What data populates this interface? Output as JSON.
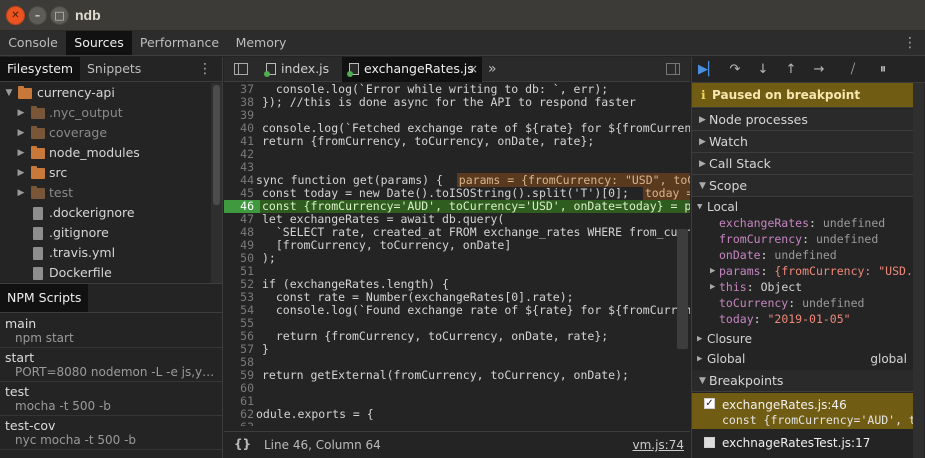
{
  "window": {
    "title": "ndb"
  },
  "main_tabs": [
    "Console",
    "Sources",
    "Performance",
    "Memory"
  ],
  "left": {
    "tabs": [
      "Filesystem",
      "Snippets"
    ],
    "tree": [
      {
        "label": "currency-api"
      },
      {
        "label": ".nyc_output"
      },
      {
        "label": "coverage"
      },
      {
        "label": "node_modules"
      },
      {
        "label": "src"
      },
      {
        "label": "test"
      },
      {
        "label": ".dockerignore"
      },
      {
        "label": ".gitignore"
      },
      {
        "label": ".travis.yml"
      },
      {
        "label": "Dockerfile"
      }
    ],
    "npm_header": "NPM Scripts",
    "npm_scripts": [
      {
        "name": "main",
        "cmd": "npm start"
      },
      {
        "name": "start",
        "cmd": "PORT=8080 nodemon -L -e js,yml,..."
      },
      {
        "name": "test",
        "cmd": "mocha -t 500 -b"
      },
      {
        "name": "test-cov",
        "cmd": "nyc mocha -t 500 -b"
      }
    ]
  },
  "editor": {
    "tabs": [
      "index.js",
      "exchangeRates.js"
    ],
    "more": "»",
    "close": "×",
    "lines": [
      {
        "n": "37",
        "t": "  console.log(`Error while writing to db: `, err);"
      },
      {
        "n": "38",
        "t": "}); //this is done async for the API to respond faster"
      },
      {
        "n": "39",
        "t": ""
      },
      {
        "n": "40",
        "t": "console.log(`Fetched exchange rate of ${rate} for ${fromCurrency}"
      },
      {
        "n": "41",
        "t": "return {fromCurrency, toCurrency, onDate, rate};"
      },
      {
        "n": "42",
        "t": ""
      },
      {
        "n": "43",
        "t": ""
      },
      {
        "n": "44",
        "t": "sync function get(params) {",
        "inline": "params = {fromCurrency: \"USD\", toCur"
      },
      {
        "n": "45",
        "t": "const today = new Date().toISOString().split('T')[0];",
        "inline": "today = \""
      },
      {
        "n": "46",
        "t": "const {fromCurrency='AUD', toCurrency='USD', onDate=today} = para"
      },
      {
        "n": "47",
        "t": "let exchangeRates = await db.query("
      },
      {
        "n": "48",
        "t": "  `SELECT rate, created_at FROM exchange_rates WHERE from_curre"
      },
      {
        "n": "49",
        "t": "  [fromCurrency, toCurrency, onDate]"
      },
      {
        "n": "50",
        "t": ");"
      },
      {
        "n": "51",
        "t": ""
      },
      {
        "n": "52",
        "t": "if (exchangeRates.length) {"
      },
      {
        "n": "53",
        "t": "  const rate = Number(exchangeRates[0].rate);"
      },
      {
        "n": "54",
        "t": "  console.log(`Found exchange rate of ${rate} for ${fromCurrency},"
      },
      {
        "n": "55",
        "t": ""
      },
      {
        "n": "56",
        "t": "  return {fromCurrency, toCurrency, onDate, rate};"
      },
      {
        "n": "57",
        "t": "}"
      },
      {
        "n": "58",
        "t": ""
      },
      {
        "n": "59",
        "t": "return getExternal(fromCurrency, toCurrency, onDate);"
      },
      {
        "n": "60",
        "t": ""
      },
      {
        "n": "61",
        "t": ""
      },
      {
        "n": "62",
        "t": "odule.exports = {"
      },
      {
        "n": "63",
        "t": ""
      }
    ],
    "status": {
      "pretty_print": "{}",
      "cursor": "Line 46, Column 64",
      "source_link": "vm.js:74"
    }
  },
  "debugger": {
    "paused_icon": "ℹ",
    "paused": "Paused on breakpoint",
    "sections": {
      "node_processes": "Node processes",
      "watch": "Watch",
      "call_stack": "Call Stack",
      "scope": "Scope",
      "local": "Local",
      "closure": "Closure",
      "global": "Global",
      "global_value": "global",
      "breakpoints": "Breakpoints"
    },
    "scope_vars": [
      {
        "key": "exchangeRates",
        "sep": ": ",
        "val": "undefined"
      },
      {
        "key": "fromCurrency",
        "sep": ": ",
        "val": "undefined"
      },
      {
        "key": "onDate",
        "sep": ": ",
        "val": "undefined"
      },
      {
        "key": "params",
        "sep": ": ",
        "val": "{fromCurrency: \"USD..."
      },
      {
        "key": "this",
        "sep": ": ",
        "val": "Object"
      },
      {
        "key": "toCurrency",
        "sep": ": ",
        "val": "undefined"
      },
      {
        "key": "today",
        "sep": ": ",
        "val": "\"2019-01-05\""
      }
    ],
    "breakpoints": [
      {
        "file": "exchangeRates.js:46",
        "code": "const {fromCurrency='AUD', to"
      },
      {
        "file": "exchnageRatesTest.js:17",
        "code": ""
      }
    ]
  },
  "colors": {
    "paused_banner": "#705d13",
    "exec_line": "#2f5d1f",
    "resume_accent": "#4a90e2",
    "ubuntu_close": "#e95420"
  }
}
